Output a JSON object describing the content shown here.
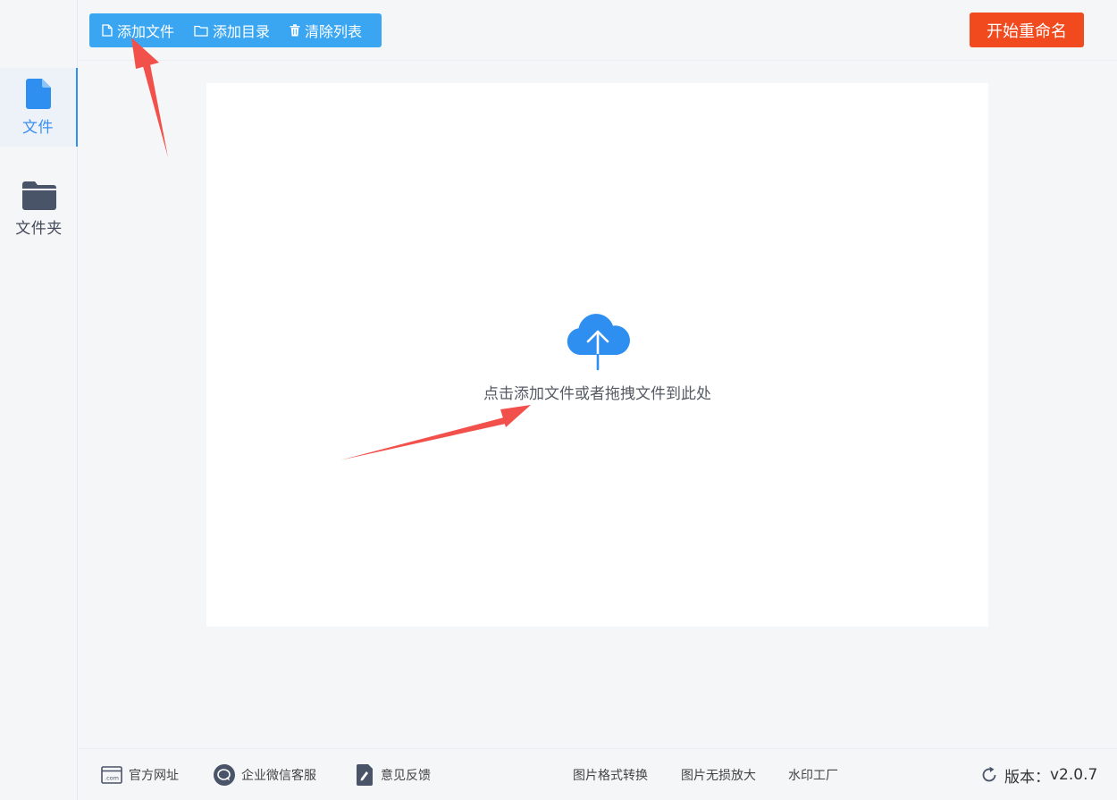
{
  "sidebar": {
    "items": [
      {
        "label": "文件",
        "icon": "file-icon",
        "active": true
      },
      {
        "label": "文件夹",
        "icon": "folder-icon",
        "active": false
      }
    ]
  },
  "toolbar": {
    "add_file": "添加文件",
    "add_dir": "添加目录",
    "clear_list": "清除列表",
    "start_rename": "开始重命名"
  },
  "dropzone": {
    "icon": "cloud-upload-icon",
    "text": "点击添加文件或者拖拽文件到此处"
  },
  "footer": {
    "website": "官方网址",
    "wechat": "企业微信客服",
    "feedback": "意见反馈",
    "format_convert": "图片格式转换",
    "lossless_enlarge": "图片无损放大",
    "watermark": "水印工厂",
    "version_label": "版本：",
    "version": "v2.0.7"
  },
  "colors": {
    "accent_blue": "#3aa6f2",
    "start_orange": "#f04a1e",
    "sidebar_active": "#2f90f0",
    "annotation_red": "#f2504b"
  }
}
